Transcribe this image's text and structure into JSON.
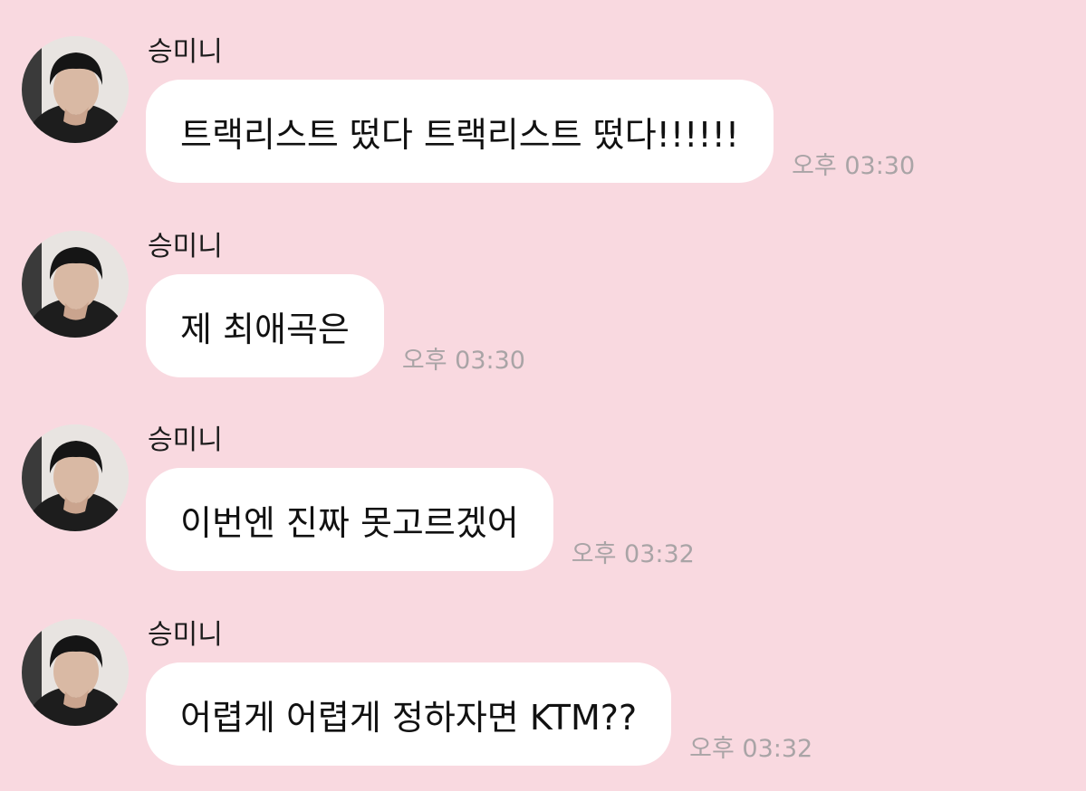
{
  "colors": {
    "background": "#f9d9e0",
    "bubble": "#ffffff",
    "timestamp": "#a9a4a6"
  },
  "messages": [
    {
      "sender": "승미니",
      "text": "트랙리스트 떴다 트랙리스트 떴다!!!!!!",
      "time": "오후 03:30",
      "avatar_icon": "profile-photo"
    },
    {
      "sender": "승미니",
      "text": "제 최애곡은",
      "time": "오후 03:30",
      "avatar_icon": "profile-photo"
    },
    {
      "sender": "승미니",
      "text": "이번엔 진짜 못고르겠어",
      "time": "오후 03:32",
      "avatar_icon": "profile-photo"
    },
    {
      "sender": "승미니",
      "text": "어렵게 어렵게 정하자면 KTM??",
      "time": "오후 03:32",
      "avatar_icon": "profile-photo"
    }
  ]
}
